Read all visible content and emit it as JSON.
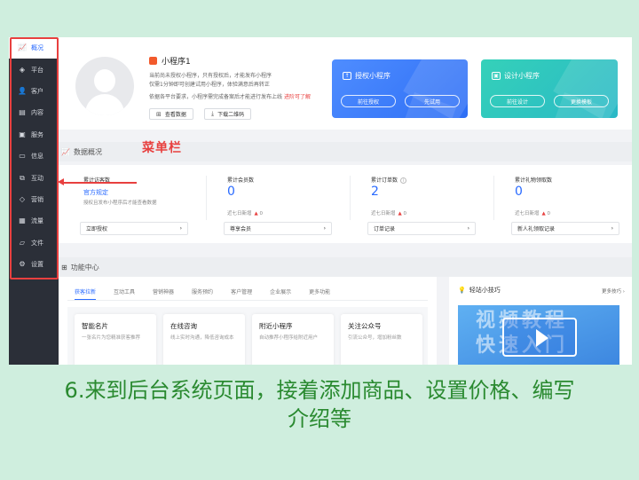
{
  "sidebar": {
    "items": [
      {
        "label": "概况",
        "icon": "chart-icon",
        "active": true
      },
      {
        "label": "平台",
        "icon": "layers-icon"
      },
      {
        "label": "客户",
        "icon": "user-icon"
      },
      {
        "label": "内容",
        "icon": "document-icon"
      },
      {
        "label": "服务",
        "icon": "service-icon"
      },
      {
        "label": "信息",
        "icon": "message-icon"
      },
      {
        "label": "互动",
        "icon": "interact-icon"
      },
      {
        "label": "营销",
        "icon": "tag-icon"
      },
      {
        "label": "流量",
        "icon": "box-icon"
      },
      {
        "label": "文件",
        "icon": "folder-icon"
      },
      {
        "label": "设置",
        "icon": "gear-icon"
      }
    ]
  },
  "annotation": {
    "menu_label": "菜单栏",
    "color": "#e8403f"
  },
  "profile": {
    "app_name": "小程序1",
    "desc_line1": "当前尚未授权小程序，只有授权后，才能发布小程序",
    "desc_line2": "仅需1分钟即可创建试用小程序，体验满意后再转正",
    "desc_line3": "依据各平台要求，小程序需完成备案后才能进行发布上线",
    "desc_link": "进阶可了解",
    "btn_view_data": "查看数据",
    "btn_download_qr": "下载二维码"
  },
  "cards": {
    "authorize": {
      "title": "授权小程序",
      "btn1": "前往授权",
      "btn2": "先试用"
    },
    "design": {
      "title": "设计小程序",
      "btn1": "前往设计",
      "btn2": "更换模板"
    }
  },
  "data_overview": {
    "title": "数据概况",
    "stats": [
      {
        "label": "累计访客数",
        "value": "官方规定",
        "note": "授权且发布小程序后才能查看数据",
        "box": "立即授权"
      },
      {
        "label": "累计会员数",
        "value": "0",
        "sub": "近七日新增",
        "delta": "0",
        "box": "尊享会员"
      },
      {
        "label": "累计订单数",
        "value": "2",
        "sub": "近七日新增",
        "delta": "0",
        "box": "订单记录"
      },
      {
        "label": "累计礼物领取数",
        "value": "0",
        "sub": "近七日新增",
        "delta": "0",
        "box": "新人礼领取记录"
      }
    ]
  },
  "function_center": {
    "title": "功能中心",
    "tabs": [
      "获客拉新",
      "互动工具",
      "营销神器",
      "服务预约",
      "客户管理",
      "企业展示",
      "更多功能"
    ],
    "cards": [
      {
        "title": "智能名片",
        "desc": "一张名片为您精准获客推荐"
      },
      {
        "title": "在线咨询",
        "desc": "线上实时沟通，降低咨询成本"
      },
      {
        "title": "附近小程序",
        "desc": "自动推荐小程序给附近用户"
      },
      {
        "title": "关注公众号",
        "desc": "引流公众号，增加粉丝数"
      }
    ]
  },
  "tips": {
    "title": "轻站小技巧",
    "more": "更多技巧",
    "video_text1": "视频教程",
    "video_text2": "快速入门"
  },
  "caption": {
    "line1": "6.来到后台系统页面，接着添加商品、设置价格、编写",
    "line2": "介绍等"
  },
  "colors": {
    "accent": "#2a6bff",
    "annotation_red": "#e8403f",
    "caption_green": "#2a8a30",
    "sidebar_bg": "#2b2f38"
  }
}
